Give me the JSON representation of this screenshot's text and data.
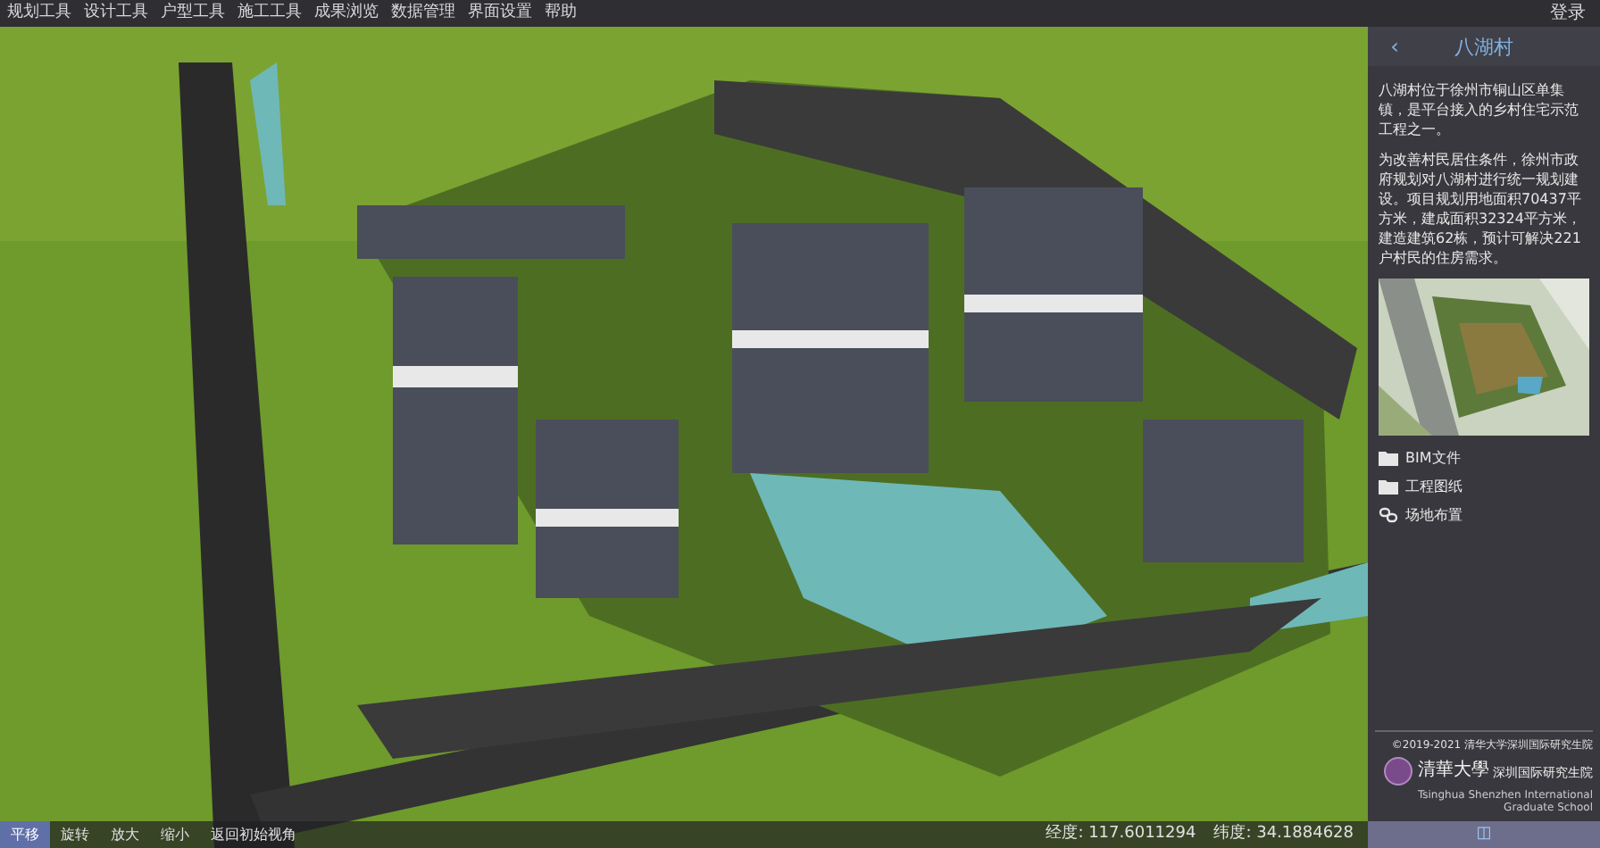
{
  "menu": {
    "items": [
      {
        "label": "规划工具"
      },
      {
        "label": "设计工具"
      },
      {
        "label": "户型工具"
      },
      {
        "label": "施工工具"
      },
      {
        "label": "成果浏览"
      },
      {
        "label": "数据管理"
      },
      {
        "label": "界面设置"
      },
      {
        "label": "帮助"
      }
    ],
    "login": "登录"
  },
  "panel": {
    "back": "‹",
    "title": "八湖村",
    "paragraphs": [
      "八湖村位于徐州市铜山区单集镇，是平台接入的乡村住宅示范工程之一。",
      "为改善村民居住条件，徐州市政府规划对八湖村进行统一规划建设。项目规划用地面积70437平方米，建成面积32324平方米，建造建筑62栋，预计可解决221户村民的住房需求。"
    ],
    "links": [
      {
        "kind": "folder",
        "label": "BIM文件"
      },
      {
        "kind": "folder",
        "label": "工程图纸"
      },
      {
        "kind": "link",
        "label": "场地布置"
      }
    ],
    "copyright": "©2019-2021 清华大学深圳国际研究生院",
    "logo_cn": "清華大學",
    "logo_name": "深圳国际研究生院",
    "logo_en": "Tsinghua Shenzhen International Graduate School",
    "toggle": "◫"
  },
  "toolbar": {
    "tools": [
      {
        "label": "平移",
        "selected": true
      },
      {
        "label": "旋转",
        "selected": false
      },
      {
        "label": "放大",
        "selected": false
      },
      {
        "label": "缩小",
        "selected": false
      },
      {
        "label": "返回初始视角",
        "selected": false
      }
    ],
    "longitude": "经度: 117.6011294",
    "latitude": "纬度: 34.1884628"
  }
}
